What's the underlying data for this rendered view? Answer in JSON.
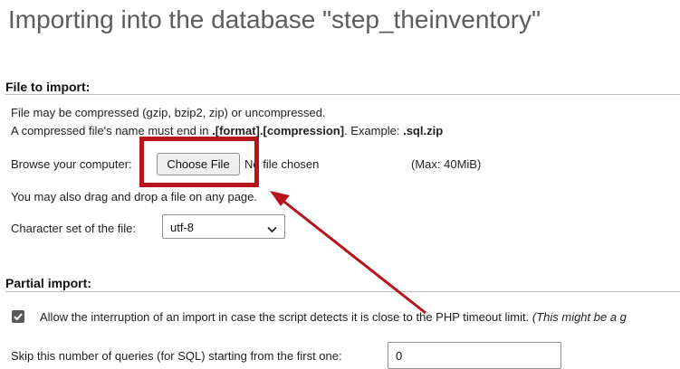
{
  "header": {
    "title": "Importing into the database \"step_theinventory\""
  },
  "file_section": {
    "title": "File to import:",
    "compress_note": "File may be compressed (gzip, bzip2, zip) or uncompressed.",
    "name_rule_prefix": "A compressed file's name must end in ",
    "name_rule_format": ".[format].[compression]",
    "name_rule_mid": ". Example: ",
    "name_rule_example": ".sql.zip",
    "browse_label": "Browse your computer:",
    "choose_file_label": "Choose File",
    "no_file_text": "No file chosen",
    "max_size": "(Max: 40MiB)",
    "drag_note": "You may also drag and drop a file on any page.",
    "charset_label": "Character set of the file:",
    "charset_value": "utf-8"
  },
  "partial_section": {
    "title": "Partial import:",
    "allow_interrupt_label": "Allow the interruption of an import in case the script detects it is close to the PHP timeout limit.",
    "allow_interrupt_note": "(This might be a g",
    "allow_interrupt_checked": true,
    "skip_label": "Skip this number of queries (for SQL) starting from the first one:",
    "skip_value": "0"
  },
  "annotation": {
    "color": "#b8141b",
    "shape": "rectangle-with-arrow",
    "target": "choose-file-button"
  }
}
